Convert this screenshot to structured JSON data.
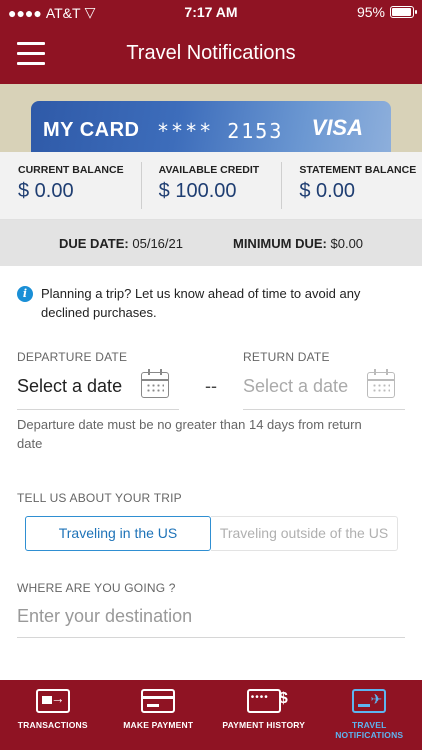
{
  "status_bar": {
    "carrier": "AT&T",
    "time": "7:17 AM",
    "battery": "95%"
  },
  "header": {
    "title": "Travel Notifications"
  },
  "card": {
    "name": "MY CARD",
    "number": "**** 2153",
    "brand": "VISA"
  },
  "balances": [
    {
      "label": "CURRENT BALANCE",
      "value": "$ 0.00"
    },
    {
      "label": "AVAILABLE CREDIT",
      "value": "$ 100.00"
    },
    {
      "label": "STATEMENT BALANCE",
      "value": "$ 0.00"
    }
  ],
  "due": {
    "due_date_label": "DUE DATE:",
    "due_date": "05/16/21",
    "min_due_label": "MINIMUM DUE:",
    "min_due": "$0.00"
  },
  "info_message": "Planning a trip? Let us know ahead of time to avoid any declined purchases.",
  "dates": {
    "departure_label": "DEPARTURE DATE",
    "departure_value": "Select a date",
    "return_label": "RETURN DATE",
    "return_value": "Select a date",
    "separator": "--",
    "helper": "Departure date must be no greater than 14 days from return date"
  },
  "trip": {
    "label": "TELL US ABOUT YOUR TRIP",
    "options": [
      "Traveling in the US",
      "Traveling outside of the US"
    ],
    "selected": "Traveling in the US"
  },
  "destination": {
    "label": "WHERE ARE YOU GOING ?",
    "placeholder": "Enter your destination",
    "value": ""
  },
  "bottom_nav": [
    {
      "label": "TRANSACTIONS",
      "icon": "transactions-icon"
    },
    {
      "label": "MAKE PAYMENT",
      "icon": "card-payment-icon"
    },
    {
      "label": "PAYMENT HISTORY",
      "icon": "payment-history-icon"
    },
    {
      "label": "TRAVEL NOTIFICATIONS",
      "icon": "travel-icon",
      "active": true
    }
  ],
  "colors": {
    "brand": "#8f1323",
    "accent": "#2f8fd2",
    "value_text": "#1f3e72",
    "active_nav": "#5db4f0"
  }
}
